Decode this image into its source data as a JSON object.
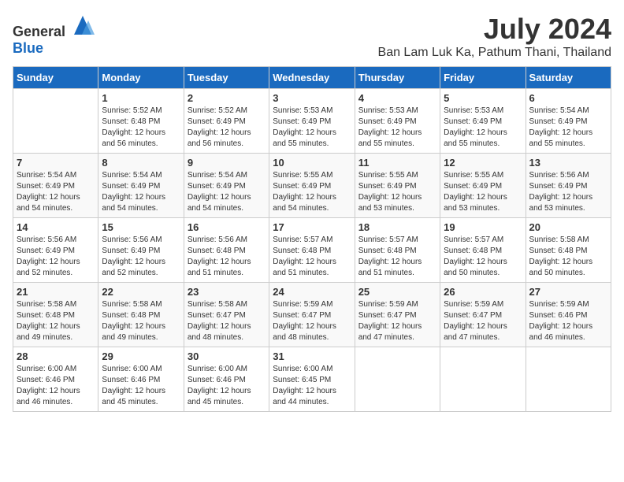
{
  "header": {
    "logo_general": "General",
    "logo_blue": "Blue",
    "title": "July 2024",
    "subtitle": "Ban Lam Luk Ka, Pathum Thani, Thailand"
  },
  "calendar": {
    "days_of_week": [
      "Sunday",
      "Monday",
      "Tuesday",
      "Wednesday",
      "Thursday",
      "Friday",
      "Saturday"
    ],
    "weeks": [
      [
        {
          "day": "",
          "info": ""
        },
        {
          "day": "1",
          "info": "Sunrise: 5:52 AM\nSunset: 6:48 PM\nDaylight: 12 hours\nand 56 minutes."
        },
        {
          "day": "2",
          "info": "Sunrise: 5:52 AM\nSunset: 6:49 PM\nDaylight: 12 hours\nand 56 minutes."
        },
        {
          "day": "3",
          "info": "Sunrise: 5:53 AM\nSunset: 6:49 PM\nDaylight: 12 hours\nand 55 minutes."
        },
        {
          "day": "4",
          "info": "Sunrise: 5:53 AM\nSunset: 6:49 PM\nDaylight: 12 hours\nand 55 minutes."
        },
        {
          "day": "5",
          "info": "Sunrise: 5:53 AM\nSunset: 6:49 PM\nDaylight: 12 hours\nand 55 minutes."
        },
        {
          "day": "6",
          "info": "Sunrise: 5:54 AM\nSunset: 6:49 PM\nDaylight: 12 hours\nand 55 minutes."
        }
      ],
      [
        {
          "day": "7",
          "info": "Sunrise: 5:54 AM\nSunset: 6:49 PM\nDaylight: 12 hours\nand 54 minutes."
        },
        {
          "day": "8",
          "info": "Sunrise: 5:54 AM\nSunset: 6:49 PM\nDaylight: 12 hours\nand 54 minutes."
        },
        {
          "day": "9",
          "info": "Sunrise: 5:54 AM\nSunset: 6:49 PM\nDaylight: 12 hours\nand 54 minutes."
        },
        {
          "day": "10",
          "info": "Sunrise: 5:55 AM\nSunset: 6:49 PM\nDaylight: 12 hours\nand 54 minutes."
        },
        {
          "day": "11",
          "info": "Sunrise: 5:55 AM\nSunset: 6:49 PM\nDaylight: 12 hours\nand 53 minutes."
        },
        {
          "day": "12",
          "info": "Sunrise: 5:55 AM\nSunset: 6:49 PM\nDaylight: 12 hours\nand 53 minutes."
        },
        {
          "day": "13",
          "info": "Sunrise: 5:56 AM\nSunset: 6:49 PM\nDaylight: 12 hours\nand 53 minutes."
        }
      ],
      [
        {
          "day": "14",
          "info": "Sunrise: 5:56 AM\nSunset: 6:49 PM\nDaylight: 12 hours\nand 52 minutes."
        },
        {
          "day": "15",
          "info": "Sunrise: 5:56 AM\nSunset: 6:49 PM\nDaylight: 12 hours\nand 52 minutes."
        },
        {
          "day": "16",
          "info": "Sunrise: 5:56 AM\nSunset: 6:48 PM\nDaylight: 12 hours\nand 51 minutes."
        },
        {
          "day": "17",
          "info": "Sunrise: 5:57 AM\nSunset: 6:48 PM\nDaylight: 12 hours\nand 51 minutes."
        },
        {
          "day": "18",
          "info": "Sunrise: 5:57 AM\nSunset: 6:48 PM\nDaylight: 12 hours\nand 51 minutes."
        },
        {
          "day": "19",
          "info": "Sunrise: 5:57 AM\nSunset: 6:48 PM\nDaylight: 12 hours\nand 50 minutes."
        },
        {
          "day": "20",
          "info": "Sunrise: 5:58 AM\nSunset: 6:48 PM\nDaylight: 12 hours\nand 50 minutes."
        }
      ],
      [
        {
          "day": "21",
          "info": "Sunrise: 5:58 AM\nSunset: 6:48 PM\nDaylight: 12 hours\nand 49 minutes."
        },
        {
          "day": "22",
          "info": "Sunrise: 5:58 AM\nSunset: 6:48 PM\nDaylight: 12 hours\nand 49 minutes."
        },
        {
          "day": "23",
          "info": "Sunrise: 5:58 AM\nSunset: 6:47 PM\nDaylight: 12 hours\nand 48 minutes."
        },
        {
          "day": "24",
          "info": "Sunrise: 5:59 AM\nSunset: 6:47 PM\nDaylight: 12 hours\nand 48 minutes."
        },
        {
          "day": "25",
          "info": "Sunrise: 5:59 AM\nSunset: 6:47 PM\nDaylight: 12 hours\nand 47 minutes."
        },
        {
          "day": "26",
          "info": "Sunrise: 5:59 AM\nSunset: 6:47 PM\nDaylight: 12 hours\nand 47 minutes."
        },
        {
          "day": "27",
          "info": "Sunrise: 5:59 AM\nSunset: 6:46 PM\nDaylight: 12 hours\nand 46 minutes."
        }
      ],
      [
        {
          "day": "28",
          "info": "Sunrise: 6:00 AM\nSunset: 6:46 PM\nDaylight: 12 hours\nand 46 minutes."
        },
        {
          "day": "29",
          "info": "Sunrise: 6:00 AM\nSunset: 6:46 PM\nDaylight: 12 hours\nand 45 minutes."
        },
        {
          "day": "30",
          "info": "Sunrise: 6:00 AM\nSunset: 6:46 PM\nDaylight: 12 hours\nand 45 minutes."
        },
        {
          "day": "31",
          "info": "Sunrise: 6:00 AM\nSunset: 6:45 PM\nDaylight: 12 hours\nand 44 minutes."
        },
        {
          "day": "",
          "info": ""
        },
        {
          "day": "",
          "info": ""
        },
        {
          "day": "",
          "info": ""
        }
      ]
    ]
  }
}
